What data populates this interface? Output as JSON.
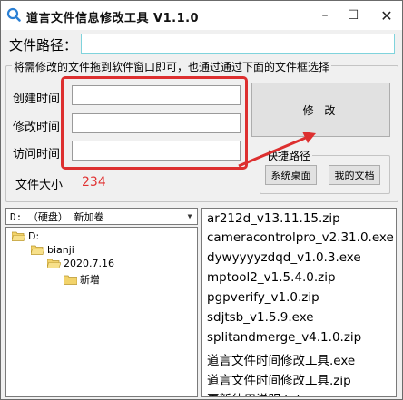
{
  "window": {
    "title": "道言文件信息修改工具 V1.1.0",
    "minimize": "–",
    "maximize": "☐",
    "close": "✕"
  },
  "path": {
    "label": "文件路径：",
    "value": ""
  },
  "main_group": {
    "title": "将需修改的文件拖到软件窗口即可，也通过通过下面的文件框选择",
    "created_label": "创建时间",
    "modified_label": "修改时间",
    "accessed_label": "访问时间",
    "created_value": "",
    "modified_value": "",
    "accessed_value": "",
    "modify_button": "修 改",
    "size_label": "文件大小",
    "size_value": "234"
  },
  "quick": {
    "title": "快捷路径",
    "desktop_button": "系统桌面",
    "docs_button": "我的文档"
  },
  "drive": {
    "selected": "D: （硬盘） 新加卷"
  },
  "tree": [
    "D:",
    "bianji",
    "2020.7.16",
    "新增"
  ],
  "files": [
    "ar212d_v13.11.15.zip",
    "cameracontrolpro_v2.31.0.exe",
    "dywyyyyzdqd_v1.0.3.exe",
    "mptool2_v1.5.4.0.zip",
    "pgpverify_v1.0.zip",
    "sdjtsb_v1.5.9.exe",
    "splitandmerge_v4.1.0.zip",
    "道言文件时间修改工具.exe",
    "道言文件时间修改工具.zip",
    "更新使用说明.txt"
  ],
  "colors": {
    "annotation": "#dd2f2f",
    "path_border": "#7fd3dc",
    "size_value": "#e03030"
  }
}
